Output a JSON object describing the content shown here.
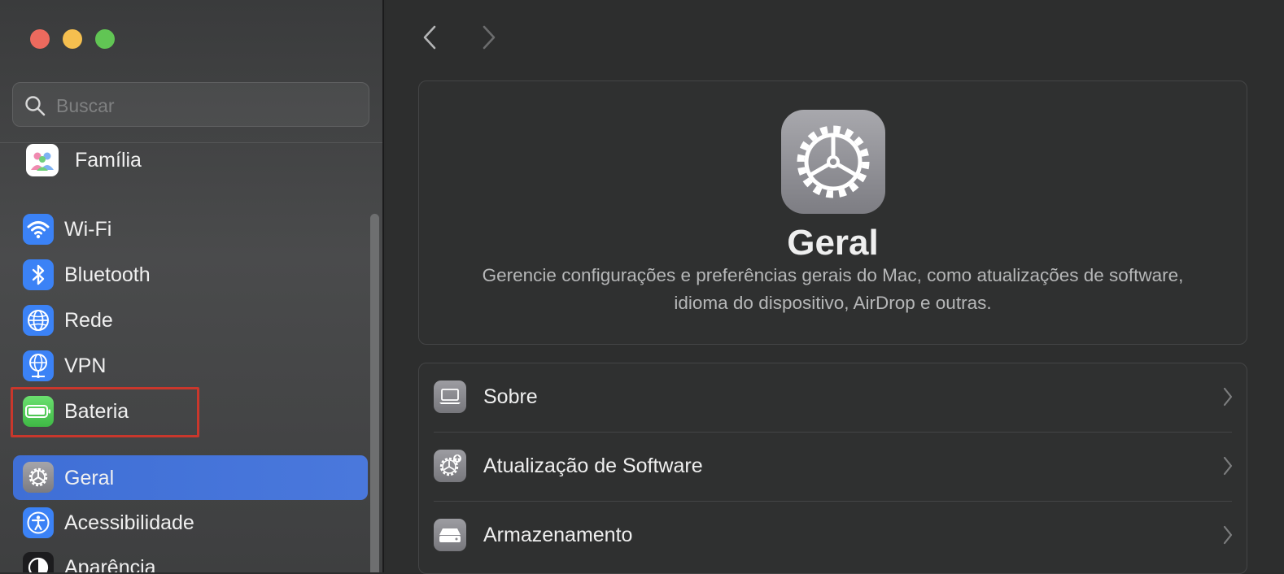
{
  "window": {
    "controls": [
      "close",
      "minimize",
      "zoom"
    ]
  },
  "sidebar": {
    "search": {
      "placeholder": "Buscar",
      "icon": "search-icon"
    },
    "items": [
      {
        "label": "Família",
        "icon": "family-icon",
        "color": "#ffffff"
      },
      {
        "label": "Wi-Fi",
        "icon": "wifi-icon",
        "color": "#3b82f6"
      },
      {
        "label": "Bluetooth",
        "icon": "bluetooth-icon",
        "color": "#3b82f6"
      },
      {
        "label": "Rede",
        "icon": "globe-icon",
        "color": "#3b82f6"
      },
      {
        "label": "VPN",
        "icon": "vpn-globe-icon",
        "color": "#3b82f6"
      },
      {
        "label": "Bateria",
        "icon": "battery-icon",
        "color": "#4cc751"
      },
      {
        "label": "Geral",
        "icon": "gear-icon",
        "color": "#8e8e93",
        "selected": true
      },
      {
        "label": "Acessibilidade",
        "icon": "accessibility-icon",
        "color": "#3b82f6"
      },
      {
        "label": "Aparência",
        "icon": "appearance-icon",
        "color": "#1c1c1e"
      }
    ],
    "highlighted_item": "Bateria"
  },
  "main": {
    "header": {
      "icon": "gear-icon",
      "title": "Geral",
      "description_line1": "Gerencie configurações e preferências gerais do Mac, como atualizações de software,",
      "description_line2": "idioma do dispositivo, AirDrop e outras."
    },
    "rows": [
      {
        "label": "Sobre",
        "icon": "laptop-icon"
      },
      {
        "label": "Atualização de Software",
        "icon": "software-update-icon"
      },
      {
        "label": "Armazenamento",
        "icon": "storage-drive-icon"
      }
    ]
  },
  "colors": {
    "accent": "#3f6fd6",
    "highlight_box": "#c9372c"
  }
}
